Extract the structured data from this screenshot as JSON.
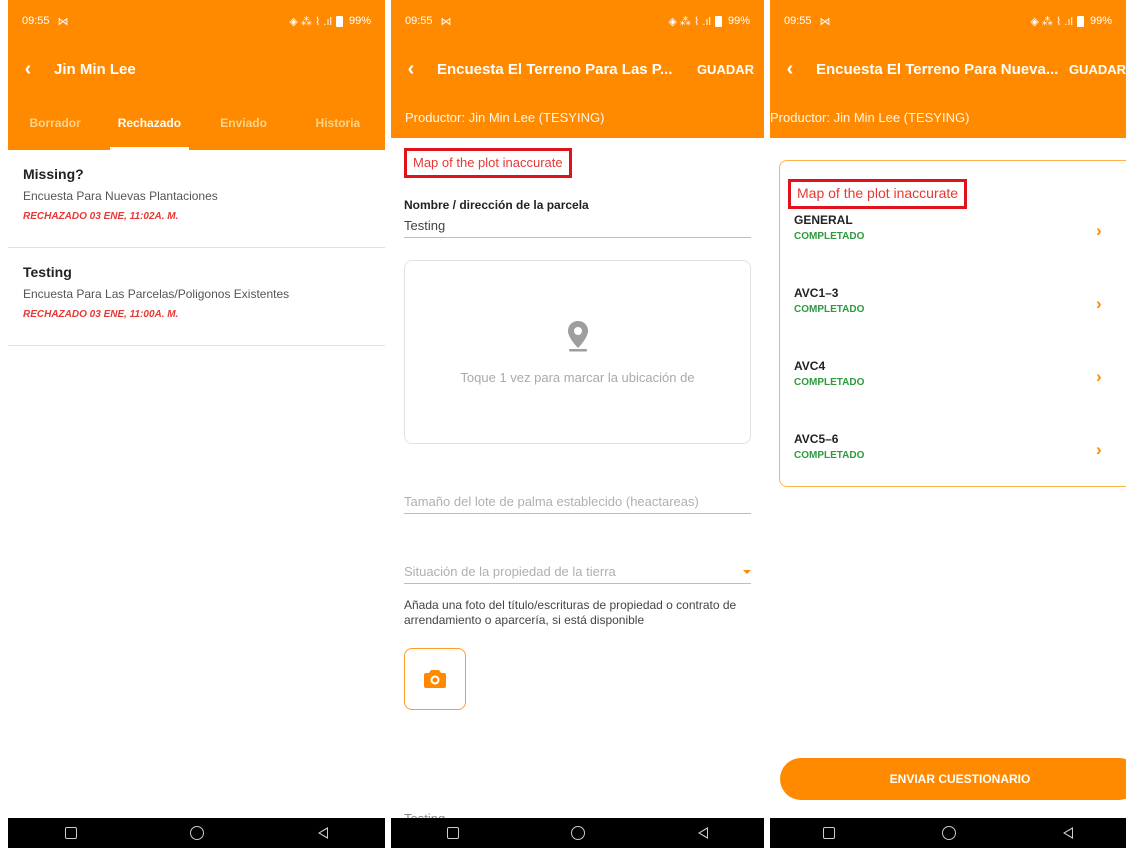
{
  "status_bar": {
    "time": "09:55",
    "notif": "⋈",
    "icons": "◈ ⁂ ⌇ .ıl",
    "battery": "99%"
  },
  "screen1": {
    "title": "Jin Min Lee",
    "tabs": [
      {
        "label": "Borrador",
        "active": false
      },
      {
        "label": "Rechazado",
        "active": true
      },
      {
        "label": "Enviado",
        "active": false
      },
      {
        "label": "Historia",
        "active": false
      }
    ],
    "items": [
      {
        "title": "Missing?",
        "survey": "Encuesta Para Nuevas Plantaciones",
        "status": "RECHAZADO 03 ENE, 11:02A. M."
      },
      {
        "title": "Testing",
        "survey": "Encuesta Para Las Parcelas/Poligonos Existentes",
        "status": "RECHAZADO 03 ENE, 11:00A. M."
      }
    ]
  },
  "screen2": {
    "title": "Encuesta El Terreno Para Las P...",
    "save_label": "GUADAR",
    "producer": "Productor: Jin Min Lee (TESYING)",
    "error": "Map of the plot inaccurate",
    "plot_label": "Nombre / dirección de la parcela",
    "plot_value": "Testing",
    "map_hint": "Toque 1 vez para marcar la ubicación de",
    "size_placeholder": "Tamaño del lote de palma establecido (heactareas)",
    "ownership_placeholder": "Situación de la propiedad de la tierra",
    "photo_desc": "Añada una foto del título/escrituras de propiedad o contrato de arrendamiento o aparcería, si está disponible",
    "bottom_value": "Testing"
  },
  "screen3": {
    "title": "Encuesta El Terreno Para Nueva...",
    "save_label": "GUADAR",
    "producer": "Productor: Jin Min Lee (TESYING)",
    "error": "Map of the plot inaccurate",
    "sections": [
      {
        "name": "GENERAL",
        "status": "COMPLETADO"
      },
      {
        "name": "AVC1–3",
        "status": "COMPLETADO"
      },
      {
        "name": "AVC4",
        "status": "COMPLETADO"
      },
      {
        "name": "AVC5–6",
        "status": "COMPLETADO"
      }
    ],
    "submit_label": "ENVIAR CUESTIONARIO"
  },
  "colors": {
    "primary": "#ff8a00",
    "error": "#e53935",
    "success": "#2e9b3f",
    "highlight": "#e0121c"
  }
}
